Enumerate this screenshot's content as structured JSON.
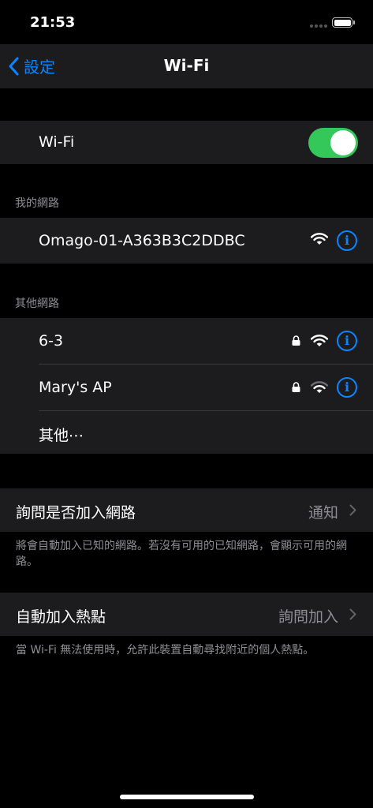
{
  "status_bar": {
    "time": "21:53"
  },
  "nav": {
    "back_label": "設定",
    "title": "Wi-Fi"
  },
  "wifi_toggle": {
    "label": "Wi-Fi",
    "on": true
  },
  "my_networks": {
    "header": "我的網路",
    "items": [
      {
        "name": "Omago-01-A363B3C2DDBC",
        "secured": false
      }
    ]
  },
  "other_networks": {
    "header": "其他網路",
    "items": [
      {
        "name": "6-3",
        "secured": true
      },
      {
        "name": "Mary's AP",
        "secured": true
      }
    ],
    "other_label": "其他⋯"
  },
  "ask_to_join": {
    "label": "詢問是否加入網路",
    "value": "通知",
    "footer": "將會自動加入已知的網路。若沒有可用的已知網路，會顯示可用的網路。"
  },
  "auto_join_hotspot": {
    "label": "自動加入熱點",
    "value": "詢問加入",
    "footer": "當 Wi-Fi 無法使用時，允許此裝置自動尋找附近的個人熱點。"
  },
  "colors": {
    "accent": "#0a84ff",
    "toggle_on": "#34c759",
    "secondary_text": "#8e8e93",
    "cell_bg": "#1c1c1e"
  },
  "icons": {
    "info": "i",
    "wifi": "wifi-icon",
    "lock": "lock-icon",
    "chevron": "chevron-right-icon",
    "back": "chevron-left-icon"
  }
}
